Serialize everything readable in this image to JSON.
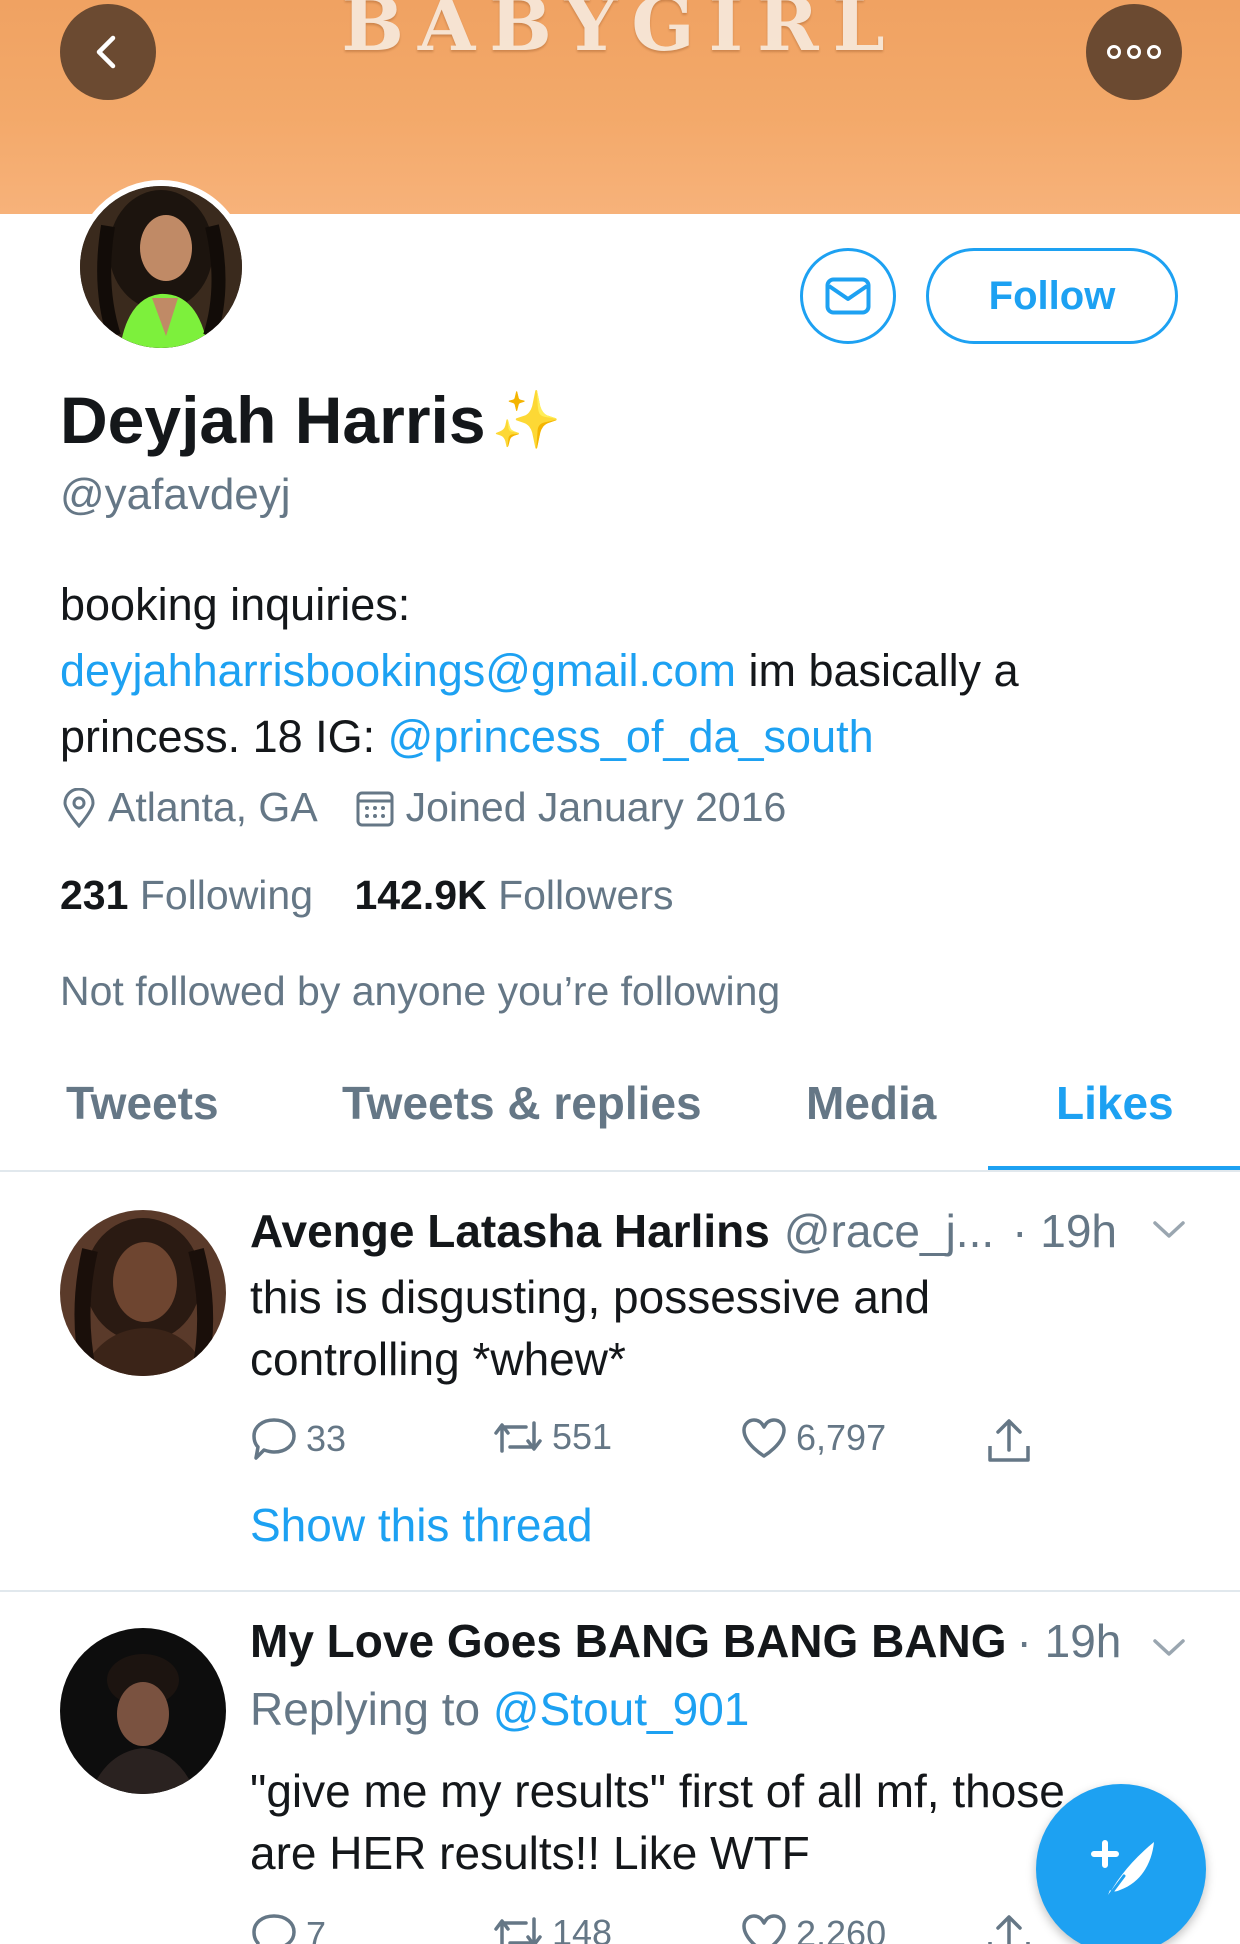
{
  "banner": {
    "text": "BABYGIRL"
  },
  "header": {
    "back_icon": "chevron-left-icon",
    "more_icon": "more-dots-icon"
  },
  "profile": {
    "name": "Deyjah Harris",
    "name_emoji": "✨",
    "handle": "@yafavdeyj",
    "bio_prefix": "booking inquiries: ",
    "bio_email": "deyjahharrisbookings@gmail.com",
    "bio_middle": " im basically a princess. 18 IG: ",
    "bio_ig": "@princess_of_da_south",
    "location": "Atlanta, GA",
    "joined": "Joined January 2016",
    "following_count": "231",
    "following_label": "Following",
    "followers_count": "142.9K",
    "followers_label": "Followers",
    "not_followed": "Not followed by anyone you’re following",
    "follow_label": "Follow",
    "message_icon": "mail-icon"
  },
  "tabs": [
    {
      "label": "Tweets",
      "active": false
    },
    {
      "label": "Tweets & replies",
      "active": false
    },
    {
      "label": "Media",
      "active": false
    },
    {
      "label": "Likes",
      "active": true
    }
  ],
  "tweets": [
    {
      "name": "Avenge Latasha Harlins",
      "handle": "@race_j...",
      "time": "· 19h",
      "text": "this is disgusting, possessive and controlling *whew*",
      "replies": "33",
      "retweets": "551",
      "likes": "6,797",
      "thread_link": "Show this thread"
    },
    {
      "name": "My Love Goes BANG BANG BANG",
      "time": "· 19h",
      "reply_prefix": "Replying to ",
      "reply_to": "@Stout_901",
      "text": "\"give me my results\" first of all mf, those are HER results!! Like WTF",
      "replies": "7",
      "retweets": "148",
      "likes": "2,260"
    }
  ],
  "colors": {
    "accent": "#1da1f2",
    "banner": "#f3a96a",
    "header_buttons": "#6b4a31",
    "secondary_text": "#657786"
  },
  "fab": {
    "icon": "compose-tweet-icon"
  }
}
